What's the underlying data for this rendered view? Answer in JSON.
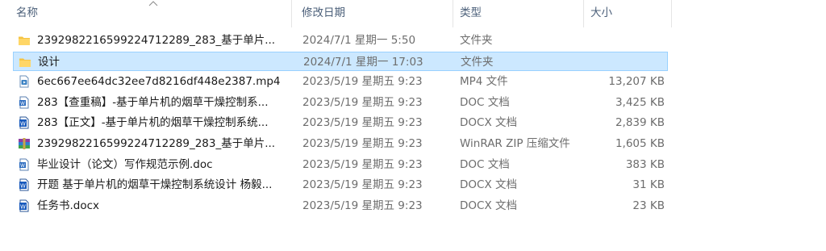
{
  "columns": {
    "name": "名称",
    "date": "修改日期",
    "type": "类型",
    "size": "大小"
  },
  "files": [
    {
      "icon": "folder-icon",
      "name": "2392982216599224712289_283_基于单片...",
      "date": "2024/7/1 星期一 5:50",
      "type": "文件夹",
      "size": ""
    },
    {
      "icon": "folder-icon",
      "name": "设计",
      "date": "2024/7/1 星期一 17:03",
      "type": "文件夹",
      "size": "",
      "selected": true
    },
    {
      "icon": "mp4-file-icon",
      "name": "6ec667ee64dc32ee7d8216df448e2387.mp4",
      "date": "2023/5/19 星期五 9:23",
      "type": "MP4 文件",
      "size": "13,207 KB"
    },
    {
      "icon": "doc-file-icon",
      "name": "283【查重稿】-基于单片机的烟草干燥控制系...",
      "date": "2023/5/19 星期五 9:23",
      "type": "DOC 文档",
      "size": "3,425 KB"
    },
    {
      "icon": "docx-file-icon",
      "name": "283【正文】-基于单片机的烟草干燥控制系统...",
      "date": "2023/5/19 星期五 9:23",
      "type": "DOCX 文档",
      "size": "2,839 KB"
    },
    {
      "icon": "winrar-archive-icon",
      "name": "2392982216599224712289_283_基于单片...",
      "date": "2023/5/19 星期五 9:23",
      "type": "WinRAR ZIP 压缩文件",
      "size": "1,605 KB"
    },
    {
      "icon": "doc-file-icon",
      "name": "毕业设计（论文）写作规范示例.doc",
      "date": "2023/5/19 星期五 9:23",
      "type": "DOC 文档",
      "size": "383 KB"
    },
    {
      "icon": "docx-file-icon",
      "name": "开题 基于单片机的烟草干燥控制系统设计 杨毅...",
      "date": "2023/5/19 星期五 9:23",
      "type": "DOCX 文档",
      "size": "31 KB"
    },
    {
      "icon": "docx-file-icon",
      "name": "任务书.docx",
      "date": "2023/5/19 星期五 9:23",
      "type": "DOCX 文档",
      "size": "23 KB"
    }
  ]
}
